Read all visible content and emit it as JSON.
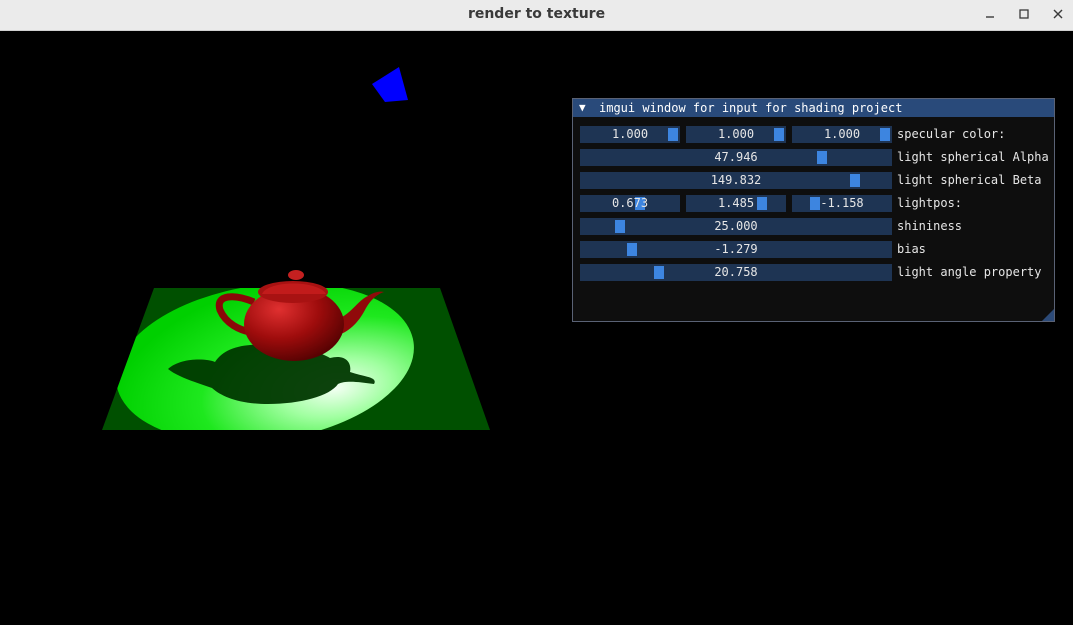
{
  "window": {
    "title": "render to texture",
    "minimize_icon": "minimize-icon",
    "maximize_icon": "maximize-icon",
    "close_icon": "close-icon"
  },
  "scene": {
    "background": "#000000",
    "floor_color": "#005000",
    "spotlight_color": "#00e000",
    "teapot_color": "#b01010",
    "light_marker_color": "#0000ff"
  },
  "imgui": {
    "collapse_icon": "triangle-down-icon",
    "title": "imgui window for input for shading project",
    "rows": [
      {
        "label": "specular color:",
        "fields": [
          {
            "value": "1.000",
            "level": 1.0
          },
          {
            "value": "1.000",
            "level": 1.0
          },
          {
            "value": "1.000",
            "level": 1.0
          }
        ]
      },
      {
        "label": "light spherical Alpha",
        "fields": [
          {
            "value": "47.946",
            "level": 0.79
          }
        ]
      },
      {
        "label": "light spherical Beta",
        "fields": [
          {
            "value": "149.832",
            "level": 0.9
          }
        ]
      },
      {
        "label": "lightpos:",
        "fields": [
          {
            "value": "0.673",
            "level": 0.62
          },
          {
            "value": "1.485",
            "level": 0.8
          },
          {
            "value": "-1.158",
            "level": 0.19
          }
        ]
      },
      {
        "label": "shininess",
        "fields": [
          {
            "value": "25.000",
            "level": 0.11
          }
        ]
      },
      {
        "label": "bias",
        "fields": [
          {
            "value": "-1.279",
            "level": 0.15
          }
        ]
      },
      {
        "label": "light angle property",
        "fields": [
          {
            "value": "20.758",
            "level": 0.24
          }
        ]
      }
    ]
  }
}
